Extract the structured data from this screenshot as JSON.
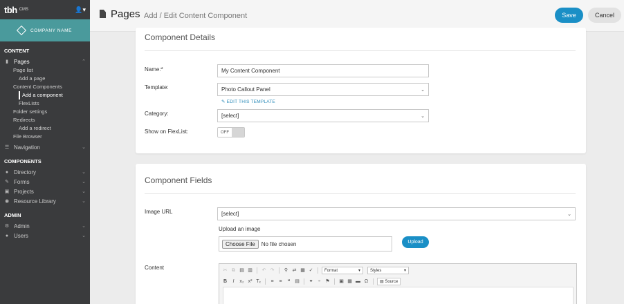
{
  "app": {
    "logo": "tbh",
    "product": "CMS"
  },
  "brand": {
    "name": "COMPANY NAME"
  },
  "sidebar": {
    "content_heading": "CONTENT",
    "pages": "Pages",
    "page_list": "Page list",
    "add_page": "Add a page",
    "content_components": "Content Components",
    "add_component": "Add a component",
    "flexlists": "FlexLists",
    "folder_settings": "Folder settings",
    "redirects": "Redirects",
    "add_redirect": "Add a redirect",
    "file_browser": "File Browser",
    "navigation": "Navigation",
    "components_heading": "COMPONENTS",
    "directory": "Directory",
    "forms": "Forms",
    "projects": "Projects",
    "resource_library": "Resource Library",
    "admin_heading": "ADMIN",
    "admin": "Admin",
    "users": "Users"
  },
  "header": {
    "title": "Pages",
    "subtitle": "Add / Edit Content Component",
    "save": "Save",
    "cancel": "Cancel"
  },
  "details": {
    "title": "Component Details",
    "name_label": "Name:*",
    "name_value": "My Content Component",
    "template_label": "Template:",
    "template_value": "Photo Callout Panel",
    "edit_template": "EDIT THIS TEMPLATE",
    "category_label": "Category:",
    "category_value": "[select]",
    "flexlist_label": "Show on FlexList:",
    "flexlist_state": "OFF"
  },
  "fields": {
    "title": "Component Fields",
    "image_url_label": "Image URL",
    "image_url_value": "[select]",
    "upload_label": "Upload an image",
    "choose_file": "Choose File",
    "no_file": "No file chosen",
    "upload_button": "Upload",
    "content_label": "Content",
    "format": "Format",
    "styles": "Styles",
    "source": "Source"
  },
  "colors": {
    "accent": "#1a8fc6",
    "brand": "#4a9a9c",
    "sidebar": "#3a3b3d"
  }
}
